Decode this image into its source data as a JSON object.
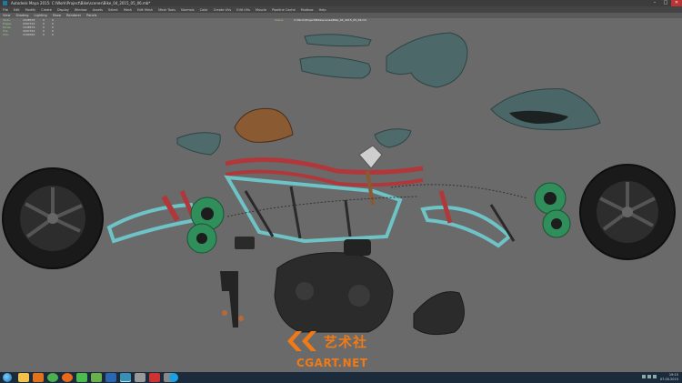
{
  "window": {
    "title": "Autodesk Maya 2015: C:\\Work\\Project\\Bike\\scenes\\Bike_04_2015_05_06.mb*",
    "controls": [
      "–",
      "□",
      "✕"
    ]
  },
  "menubar": {
    "items": [
      "File",
      "Edit",
      "Modify",
      "Create",
      "Display",
      "Window",
      "Assets",
      "Select",
      "Mesh",
      "Edit Mesh",
      "Mesh Tools",
      "Normals",
      "Color",
      "Create UVs",
      "Edit UVs",
      "Muscle",
      "Pipeline Cache",
      "Mudbox",
      "Help"
    ]
  },
  "panel_menu": {
    "items": [
      "View",
      "Shading",
      "Lighting",
      "Show",
      "Renderer",
      "Panels"
    ]
  },
  "hud": {
    "rows": [
      {
        "label": "Verts:",
        "value": "1048576",
        "a": "0",
        "b": "0"
      },
      {
        "label": "Edges:",
        "value": "2097152",
        "a": "0",
        "b": "0"
      },
      {
        "label": "Faces:",
        "value": "1048576",
        "a": "0",
        "b": "0"
      },
      {
        "label": "Tris:",
        "value": "2097152",
        "a": "0",
        "b": "0"
      },
      {
        "label": "UVs:",
        "value": "1180320",
        "a": "0",
        "b": "0"
      }
    ]
  },
  "viewport": {
    "file_label": "Scene:",
    "file_path": "C:\\Work\\Project\\Bike\\scenes\\Bike_04_2015_05_06.mb"
  },
  "watermark": {
    "cn_text": "艺术社",
    "url_text": "CGART.NET",
    "color": "#f07a16"
  },
  "taskbar": {
    "time": "19:15",
    "date": "07.05.2015",
    "buttons": [
      {
        "name": "explorer",
        "color": "#f2c24a"
      },
      {
        "name": "media",
        "color": "#e2731d"
      },
      {
        "name": "chrome",
        "color": "#4caf50"
      },
      {
        "name": "firefox",
        "color": "#e86a1c"
      },
      {
        "name": "media-player",
        "color": "#4dbb4f"
      },
      {
        "name": "mudbox",
        "color": "#6ab04c"
      },
      {
        "name": "photoshop",
        "color": "#2b67b1"
      },
      {
        "name": "maya",
        "color": "#3b8fb5"
      },
      {
        "name": "notes",
        "color": "#999999"
      },
      {
        "name": "zbrush",
        "color": "#c33"
      },
      {
        "name": "utility",
        "color": "#888888"
      },
      {
        "name": "skype",
        "color": "#1aa1e1"
      }
    ]
  },
  "colors": {
    "frame_red": "#b0383a",
    "frame_teal": "#6ec3c7",
    "panel_teal": "#4e6a6a",
    "seat_brown": "#8a5a32",
    "disc_green": "#2f8e5a"
  }
}
